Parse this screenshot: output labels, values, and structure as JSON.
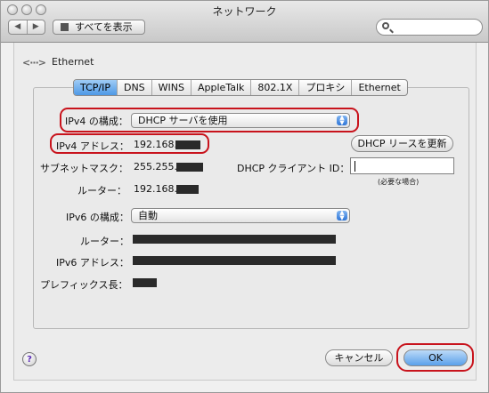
{
  "window": {
    "title": "ネットワーク"
  },
  "toolbar": {
    "back": "◀",
    "forward": "▶",
    "show_all": "すべてを表示",
    "search_placeholder": ""
  },
  "interface": {
    "icon": "<···>",
    "name": "Ethernet"
  },
  "tabs": [
    "TCP/IP",
    "DNS",
    "WINS",
    "AppleTalk",
    "802.1X",
    "プロキシ",
    "Ethernet"
  ],
  "form": {
    "ipv4_config_label": "IPv4 の構成：",
    "ipv4_config_value": "DHCP サーバを使用",
    "ipv4_address_label": "IPv4 アドレス：",
    "ipv4_address_value": "192.168.",
    "renew_button": "DHCP リースを更新",
    "subnet_label": "サブネットマスク：",
    "subnet_value": "255.255.",
    "dhcp_client_id_label": "DHCP クライアント ID：",
    "dhcp_client_id_value": "",
    "dhcp_client_id_hint": "(必要な場合)",
    "router_label": "ルーター：",
    "router_value": "192.168.",
    "ipv6_config_label": "IPv6 の構成：",
    "ipv6_config_value": "自動",
    "ipv6_router_label": "ルーター：",
    "ipv6_address_label": "IPv6 アドレス：",
    "prefix_length_label": "プレフィックス長："
  },
  "footer": {
    "help": "?",
    "cancel": "キャンセル",
    "ok": "OK"
  },
  "colors": {
    "highlight": "#c8131c",
    "selected_tab": "#4e98e6",
    "redaction": "#2a2a2a"
  }
}
